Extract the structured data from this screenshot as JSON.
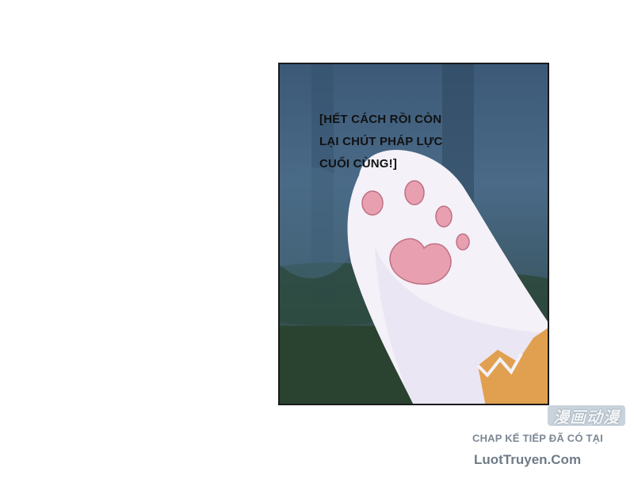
{
  "panel": {
    "caption_lines": [
      "[HẾT CÁCH RỒI CÒN",
      "LẠI CHÚT PHÁP LỰC",
      "CUỐI CÙNG!]"
    ]
  },
  "footer": {
    "logo_text": "漫画动漫",
    "next_chapter_text": "CHAP KẾ TIẾP ĐÃ CÓ TẠI",
    "site_name": "LuotTruyen.Com"
  },
  "colors": {
    "paw_pad": "#e8a0b0",
    "paw_fur": "#f4f1f8",
    "tail_orange": "#e0a050",
    "background_forest": "#3c5a78"
  }
}
